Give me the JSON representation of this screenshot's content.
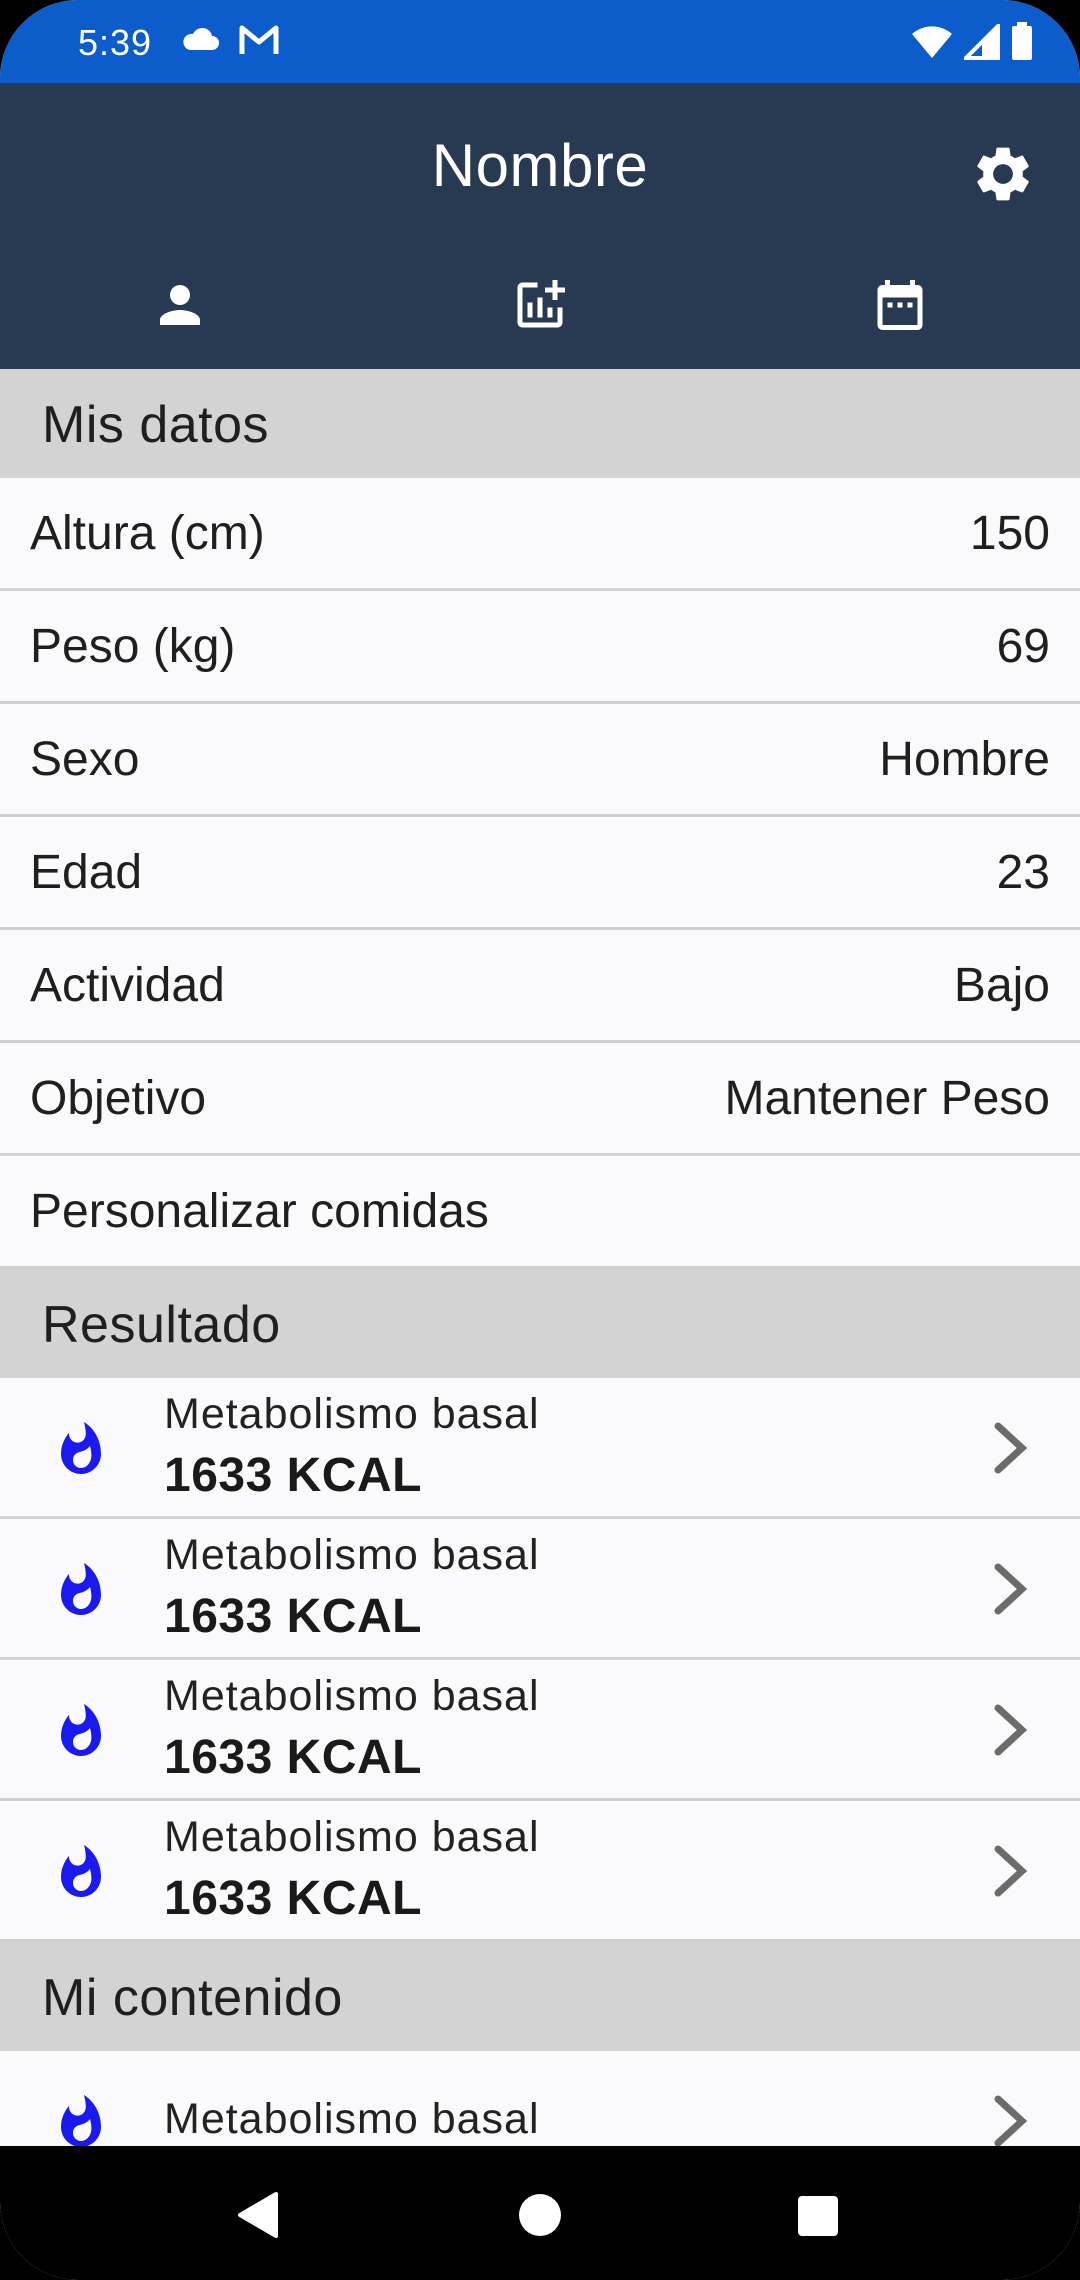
{
  "status_bar": {
    "time": "5:39",
    "left_icons": [
      "cloud-icon",
      "gmail-icon"
    ],
    "right_icons": [
      "wifi-icon",
      "signal-icon",
      "battery-icon"
    ]
  },
  "app_bar": {
    "title": "Nombre",
    "settings_icon": "gear-icon",
    "tabs": [
      {
        "icon": "person-icon"
      },
      {
        "icon": "add-chart-icon"
      },
      {
        "icon": "calendar-icon"
      }
    ]
  },
  "mis_datos": {
    "header": "Mis datos",
    "rows": [
      {
        "label": "Altura (cm)",
        "value": "150"
      },
      {
        "label": "Peso (kg)",
        "value": "69"
      },
      {
        "label": "Sexo",
        "value": "Hombre"
      },
      {
        "label": "Edad",
        "value": "23"
      },
      {
        "label": "Actividad",
        "value": "Bajo"
      },
      {
        "label": "Objetivo",
        "value": "Mantener Peso"
      },
      {
        "label": "Personalizar comidas",
        "value": ""
      }
    ]
  },
  "resultado": {
    "header": "Resultado",
    "items": [
      {
        "label": "Metabolismo basal",
        "value": "1633 KCAL"
      },
      {
        "label": "Metabolismo basal",
        "value": "1633 KCAL"
      },
      {
        "label": "Metabolismo basal",
        "value": "1633 KCAL"
      },
      {
        "label": "Metabolismo basal",
        "value": "1633 KCAL"
      }
    ]
  },
  "mi_contenido": {
    "header": "Mi contenido",
    "items": [
      {
        "label": "Metabolismo basal"
      }
    ]
  },
  "colors": {
    "status_bar": "#0d5ccc",
    "app_bar": "#283a52",
    "section_header": "#d3d3d3",
    "flame_icon": "#1a1aee"
  }
}
